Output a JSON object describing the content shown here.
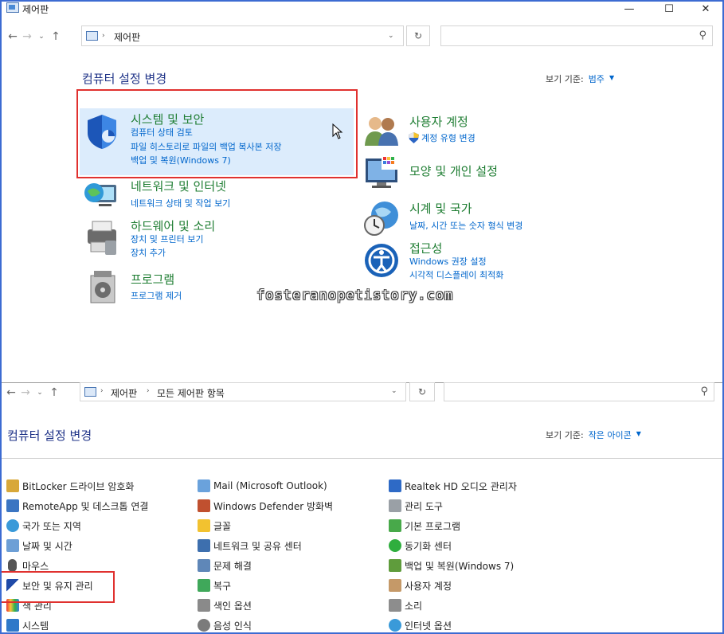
{
  "window": {
    "title": "제어판",
    "minimize": "—",
    "maximize": "☐",
    "close": "✕"
  },
  "top": {
    "address": {
      "crumbs": [
        "제어판"
      ]
    },
    "search_placeholder": "",
    "heading": "컴퓨터 설정 변경",
    "view_label": "보기 기준:",
    "view_value": "범주",
    "categories": [
      {
        "title": "시스템 및 보안",
        "links": [
          "컴퓨터 상태 검토",
          "파일 히스토리로 파일의 백업 복사본 저장",
          "백업 및 복원(Windows 7)"
        ]
      },
      {
        "title": "네트워크 및 인터넷",
        "links": [
          "네트워크 상태 및 작업 보기"
        ]
      },
      {
        "title": "하드웨어 및 소리",
        "links": [
          "장치 및 프린터 보기",
          "장치 추가"
        ]
      },
      {
        "title": "프로그램",
        "links": [
          "프로그램 제거"
        ]
      },
      {
        "title": "사용자 계정",
        "links": [
          "계정 유형 변경"
        ]
      },
      {
        "title": "모양 및 개인 설정",
        "links": []
      },
      {
        "title": "시계 및 국가",
        "links": [
          "날짜, 시간 또는 숫자 형식 변경"
        ]
      },
      {
        "title": "접근성",
        "links": [
          "Windows 권장 설정",
          "시각적 디스플레이 최적화"
        ]
      }
    ]
  },
  "bottom": {
    "address": {
      "crumbs": [
        "제어판",
        "모든 제어판 항목"
      ]
    },
    "heading": "컴퓨터 설정 변경",
    "view_label": "보기 기준:",
    "view_value": "작은 아이콘",
    "col1": [
      "BitLocker 드라이브 암호화",
      "RemoteApp 및 데스크톱 연결",
      "국가 또는 지역",
      "날짜 및 시간",
      "마우스",
      "보안 및 유지 관리",
      "색 관리",
      "시스템"
    ],
    "col2": [
      "Mail (Microsoft Outlook)",
      "Windows Defender 방화벽",
      "글꼴",
      "네트워크 및 공유 센터",
      "문제 해결",
      "복구",
      "색인 옵션",
      "음성 인식"
    ],
    "col3": [
      "Realtek HD 오디오 관리자",
      "관리 도구",
      "기본 프로그램",
      "동기화 센터",
      "백업 및 복원(Windows 7)",
      "사용자 계정",
      "소리",
      "인터넷 옵션"
    ]
  },
  "watermark": "fosteranopetistory.com",
  "colors": {
    "accent": "#0066cc",
    "category_title": "#1e7d32",
    "heading": "#1e3287",
    "highlight": "#e0312f",
    "hover": "#dcecfc"
  }
}
